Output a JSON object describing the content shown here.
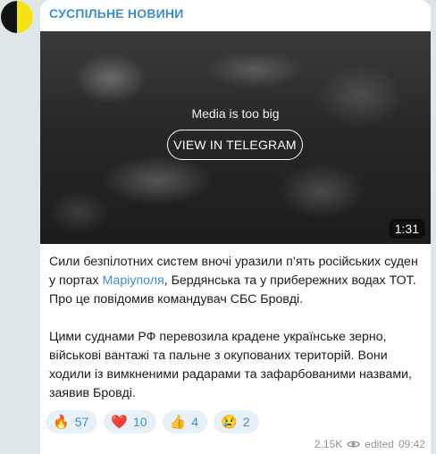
{
  "channel": {
    "name": "СУСПІЛЬНЕ НОВИНИ"
  },
  "media": {
    "label": "Media is too big",
    "button_label": "VIEW IN TELEGRAM",
    "duration": "1:31"
  },
  "message": {
    "p1_part1": "Сили безпілотних систем вночі уразили п’ять російських суден у портах ",
    "p1_link": "Маріуполя",
    "p1_part2": ", Бердянська та у прибережних водах ТОТ. Про це повідомив командувач СБС Бровді.",
    "p2": "Цими суднами РФ перевозила крадене українське зерно, військові вантажі та пальне з окупованих територій. Вони ходили із вимкненими радарами та зафарбованими назвами, заявив Бровді."
  },
  "reactions": [
    {
      "emoji": "🔥",
      "icon": "fire-icon",
      "count": "57"
    },
    {
      "emoji": "❤️",
      "icon": "heart-icon",
      "count": "10"
    },
    {
      "emoji": "👍",
      "icon": "thumbs-up-icon",
      "count": "4"
    },
    {
      "emoji": "😢",
      "icon": "crying-face-icon",
      "count": "2"
    }
  ],
  "meta": {
    "views": "2.15K",
    "edited": "edited",
    "time": "09:42"
  }
}
